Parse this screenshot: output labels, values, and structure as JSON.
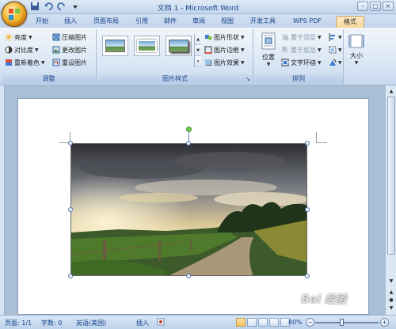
{
  "window": {
    "title": "文档 1 - Microsoft Word"
  },
  "tabs": [
    "开始",
    "插入",
    "页面布局",
    "引用",
    "邮件",
    "审阅",
    "视图",
    "开发工具",
    "WPS PDF",
    "格式"
  ],
  "active_tab": "格式",
  "ribbon": {
    "adjust": {
      "label": "调整",
      "brightness": "亮度",
      "contrast": "对比度",
      "recolor": "重新着色",
      "compress": "压缩图片",
      "change": "更改图片",
      "reset": "重设图片"
    },
    "picture_styles": {
      "label": "图片样式",
      "shape": "图片形状",
      "border": "图片边框",
      "effects": "图片效果"
    },
    "arrange": {
      "label": "排列",
      "position": "位置",
      "bring_front": "置于顶层",
      "send_back": "置于底层",
      "text_wrap": "文字环绕"
    },
    "size": {
      "label": "大小"
    }
  },
  "statusbar": {
    "page": "页面: 1/1",
    "words": "字数: 0",
    "language": "英语(美国)",
    "mode": "插入",
    "zoom": "80%"
  },
  "watermark": "Bai 经验",
  "colors": {
    "accent": "#15428b",
    "active_tab": "#f7d89a",
    "ribbon_bg": "#dbe7f5"
  }
}
